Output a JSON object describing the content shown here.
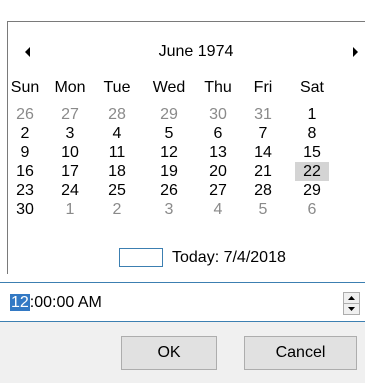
{
  "calendar": {
    "month_title": "June 1974",
    "prev_icon": "triangle-left-icon",
    "next_icon": "triangle-right-icon",
    "days_of_week": [
      "Sun",
      "Mon",
      "Tue",
      "Wed",
      "Thu",
      "Fri",
      "Sat"
    ],
    "weeks": [
      [
        {
          "d": "26",
          "o": true
        },
        {
          "d": "27",
          "o": true
        },
        {
          "d": "28",
          "o": true
        },
        {
          "d": "29",
          "o": true
        },
        {
          "d": "30",
          "o": true
        },
        {
          "d": "31",
          "o": true
        },
        {
          "d": "1"
        }
      ],
      [
        {
          "d": "2"
        },
        {
          "d": "3"
        },
        {
          "d": "4"
        },
        {
          "d": "5"
        },
        {
          "d": "6"
        },
        {
          "d": "7"
        },
        {
          "d": "8"
        }
      ],
      [
        {
          "d": "9"
        },
        {
          "d": "10"
        },
        {
          "d": "11"
        },
        {
          "d": "12"
        },
        {
          "d": "13"
        },
        {
          "d": "14"
        },
        {
          "d": "15"
        }
      ],
      [
        {
          "d": "16"
        },
        {
          "d": "17"
        },
        {
          "d": "18"
        },
        {
          "d": "19"
        },
        {
          "d": "20"
        },
        {
          "d": "21"
        },
        {
          "d": "22",
          "s": true
        }
      ],
      [
        {
          "d": "23"
        },
        {
          "d": "24"
        },
        {
          "d": "25"
        },
        {
          "d": "26"
        },
        {
          "d": "27"
        },
        {
          "d": "28"
        },
        {
          "d": "29"
        }
      ],
      [
        {
          "d": "30"
        },
        {
          "d": "1",
          "o": true
        },
        {
          "d": "2",
          "o": true
        },
        {
          "d": "3",
          "o": true
        },
        {
          "d": "4",
          "o": true
        },
        {
          "d": "5",
          "o": true
        },
        {
          "d": "6",
          "o": true
        }
      ]
    ],
    "selected_date": "22",
    "today_label": "Today: 7/4/2018"
  },
  "time": {
    "hour": "12",
    "rest": ":00:00 AM",
    "spin_up_icon": "spin-up-icon",
    "spin_down_icon": "spin-down-icon"
  },
  "buttons": {
    "ok": "OK",
    "cancel": "Cancel"
  },
  "colors": {
    "selected_bg": "#d4d4d4",
    "accent": "#3379c4",
    "other_month_text": "#8a8a8a",
    "footer_bg": "#f0f0f0"
  }
}
